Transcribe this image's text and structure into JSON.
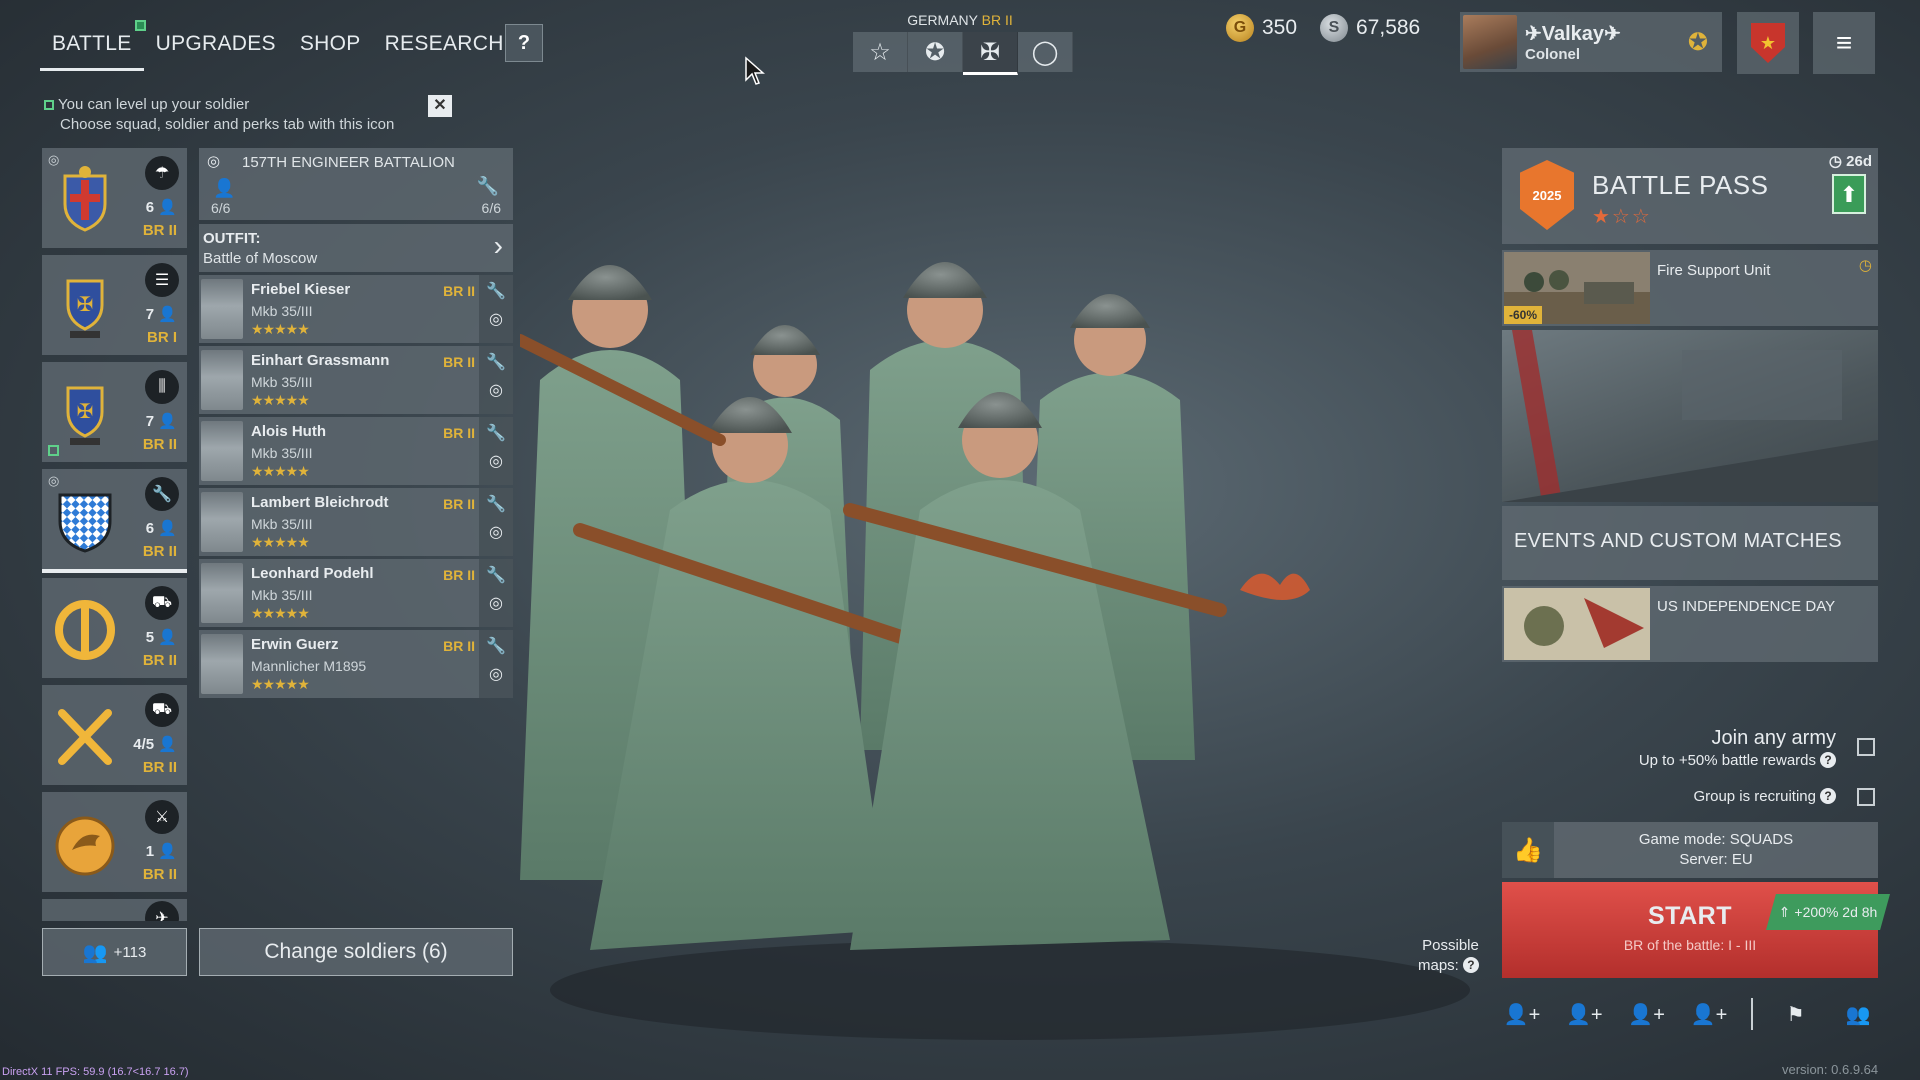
{
  "nav": {
    "tabs": [
      {
        "label": "BATTLE"
      },
      {
        "label": "UPGRADES"
      },
      {
        "label": "SHOP"
      },
      {
        "label": "RESEARCH"
      }
    ],
    "help": "?"
  },
  "hint": {
    "line1": "You can level up your soldier",
    "line2": "Choose squad, soldier and perks tab with this icon",
    "close": "✕"
  },
  "nation": {
    "name": "GERMANY",
    "br": "BR II",
    "buttons": [
      "☆",
      "✪",
      "✠",
      "◯"
    ]
  },
  "currency": {
    "gold": "350",
    "silver": "67,586"
  },
  "profile": {
    "name": "Valkay",
    "rank": "Colonel"
  },
  "squads": [
    {
      "count": "6",
      "br": "BR II",
      "role": "parachute-icon"
    },
    {
      "count": "7",
      "br": "BR I",
      "role": "list-icon"
    },
    {
      "count": "7",
      "br": "BR II",
      "role": "ammo-icon"
    },
    {
      "count": "6",
      "br": "BR II",
      "role": "wrench-icon"
    },
    {
      "count": "5",
      "br": "BR II",
      "role": "vehicle-icon"
    },
    {
      "count": "4/5",
      "br": "BR II",
      "role": "tank-icon"
    },
    {
      "count": "1",
      "br": "BR II",
      "role": "melee-icon"
    }
  ],
  "battalion": {
    "title": "157TH ENGINEER BATTALION",
    "left": "6/6",
    "right": "6/6"
  },
  "outfit": {
    "label": "OUTFIT:",
    "value": "Battle of Moscow"
  },
  "soldiers": [
    {
      "name": "Friebel Kieser",
      "weapon": "Mkb 35/III",
      "br": "BR II",
      "stars": "★★★★★"
    },
    {
      "name": "Einhart Grassmann",
      "weapon": "Mkb 35/III",
      "br": "BR II",
      "stars": "★★★★★"
    },
    {
      "name": "Alois Huth",
      "weapon": "Mkb 35/III",
      "br": "BR II",
      "stars": "★★★★★"
    },
    {
      "name": "Lambert Bleichrodt",
      "weapon": "Mkb 35/III",
      "br": "BR II",
      "stars": "★★★★★"
    },
    {
      "name": "Leonhard Podehl",
      "weapon": "Mkb 35/III",
      "br": "BR II",
      "stars": "★★★★★"
    },
    {
      "name": "Erwin Guerz",
      "weapon": "Mannlicher M1895",
      "br": "BR II",
      "stars": "★★★★★"
    }
  ],
  "reserve": {
    "count": "+113"
  },
  "change_label": "Change soldiers (6)",
  "battle_pass": {
    "title": "BATTLE PASS",
    "timer": "26d",
    "stars": "★☆☆",
    "badge": "2025"
  },
  "offer": {
    "title": "Fire Support Unit",
    "discount": "-60%"
  },
  "events": {
    "title": "EVENTS AND CUSTOM MATCHES"
  },
  "event2": {
    "title": "US INDEPENDENCE DAY"
  },
  "join": {
    "title": "Join any army",
    "sub": "Up to +50% battle rewards"
  },
  "group": {
    "label": "Group is recruiting"
  },
  "mode": {
    "line1": "Game mode: SQUADS",
    "line2": "Server: EU"
  },
  "start": {
    "label": "START",
    "sub": "BR of the battle: I - III",
    "xp": "+200% 2d 8h"
  },
  "maps": {
    "line1": "Possible",
    "line2": "maps:"
  },
  "footer": {
    "fps": "DirectX 11 FPS: 59.9 (16.7<16.7 16.7)",
    "version": "version: 0.6.9.64"
  },
  "colors": {
    "accent_gold": "#e0b33a",
    "start_red": "#c93c38",
    "xp_green": "#3e9b5d"
  }
}
